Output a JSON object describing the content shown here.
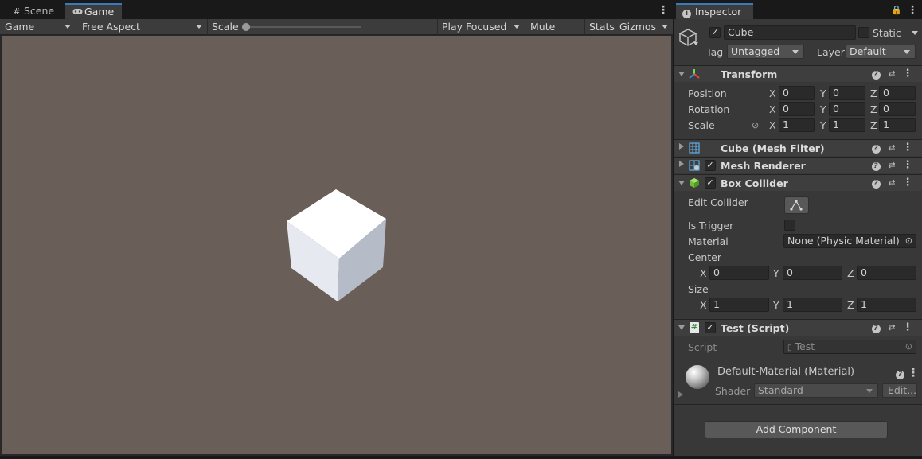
{
  "game_tabs": [
    {
      "label": "Scene",
      "icon": "scene-grid-icon"
    },
    {
      "label": "Game",
      "icon": "gamepad-icon"
    }
  ],
  "toolbar": {
    "display": "Game",
    "aspect": "Free Aspect",
    "scale_label": "Scale",
    "scale_value": "1x",
    "play_mode": "Play Focused",
    "mute": "Mute Audio",
    "stats": "Stats",
    "gizmos": "Gizmos"
  },
  "inspector": {
    "tab_label": "Inspector",
    "object": {
      "name": "Cube",
      "active": true,
      "static_label": "Static",
      "tag_label": "Tag",
      "tag_value": "Untagged",
      "layer_label": "Layer",
      "layer_value": "Default"
    },
    "transform": {
      "title": "Transform",
      "position_label": "Position",
      "rotation_label": "Rotation",
      "scale_label": "Scale",
      "position": {
        "x": "0",
        "y": "0",
        "z": "0"
      },
      "rotation": {
        "x": "0",
        "y": "0",
        "z": "0"
      },
      "scale": {
        "x": "1",
        "y": "1",
        "z": "1"
      }
    },
    "mesh_filter": {
      "title": "Cube (Mesh Filter)"
    },
    "mesh_renderer": {
      "title": "Mesh Renderer"
    },
    "box_collider": {
      "title": "Box Collider",
      "edit_label": "Edit Collider",
      "trigger_label": "Is Trigger",
      "material_label": "Material",
      "material_value": "None (Physic Material)",
      "center_label": "Center",
      "size_label": "Size",
      "center": {
        "x": "0",
        "y": "0",
        "z": "0"
      },
      "size": {
        "x": "1",
        "y": "1",
        "z": "1"
      }
    },
    "script": {
      "title": "Test (Script)",
      "field_label": "Script",
      "field_value": "Test"
    },
    "material": {
      "title": "Default-Material (Material)",
      "shader_label": "Shader",
      "shader_value": "Standard",
      "edit_label": "Edit..."
    },
    "add_component": "Add Component"
  },
  "axes": {
    "x": "X",
    "y": "Y",
    "z": "Z"
  },
  "colors": {
    "viewport": "#6a5f58",
    "accent": "#3a79bb",
    "cube_top": "#ffffff",
    "cube_left": "#e8ebf1",
    "cube_right": "#b7bdc8"
  }
}
